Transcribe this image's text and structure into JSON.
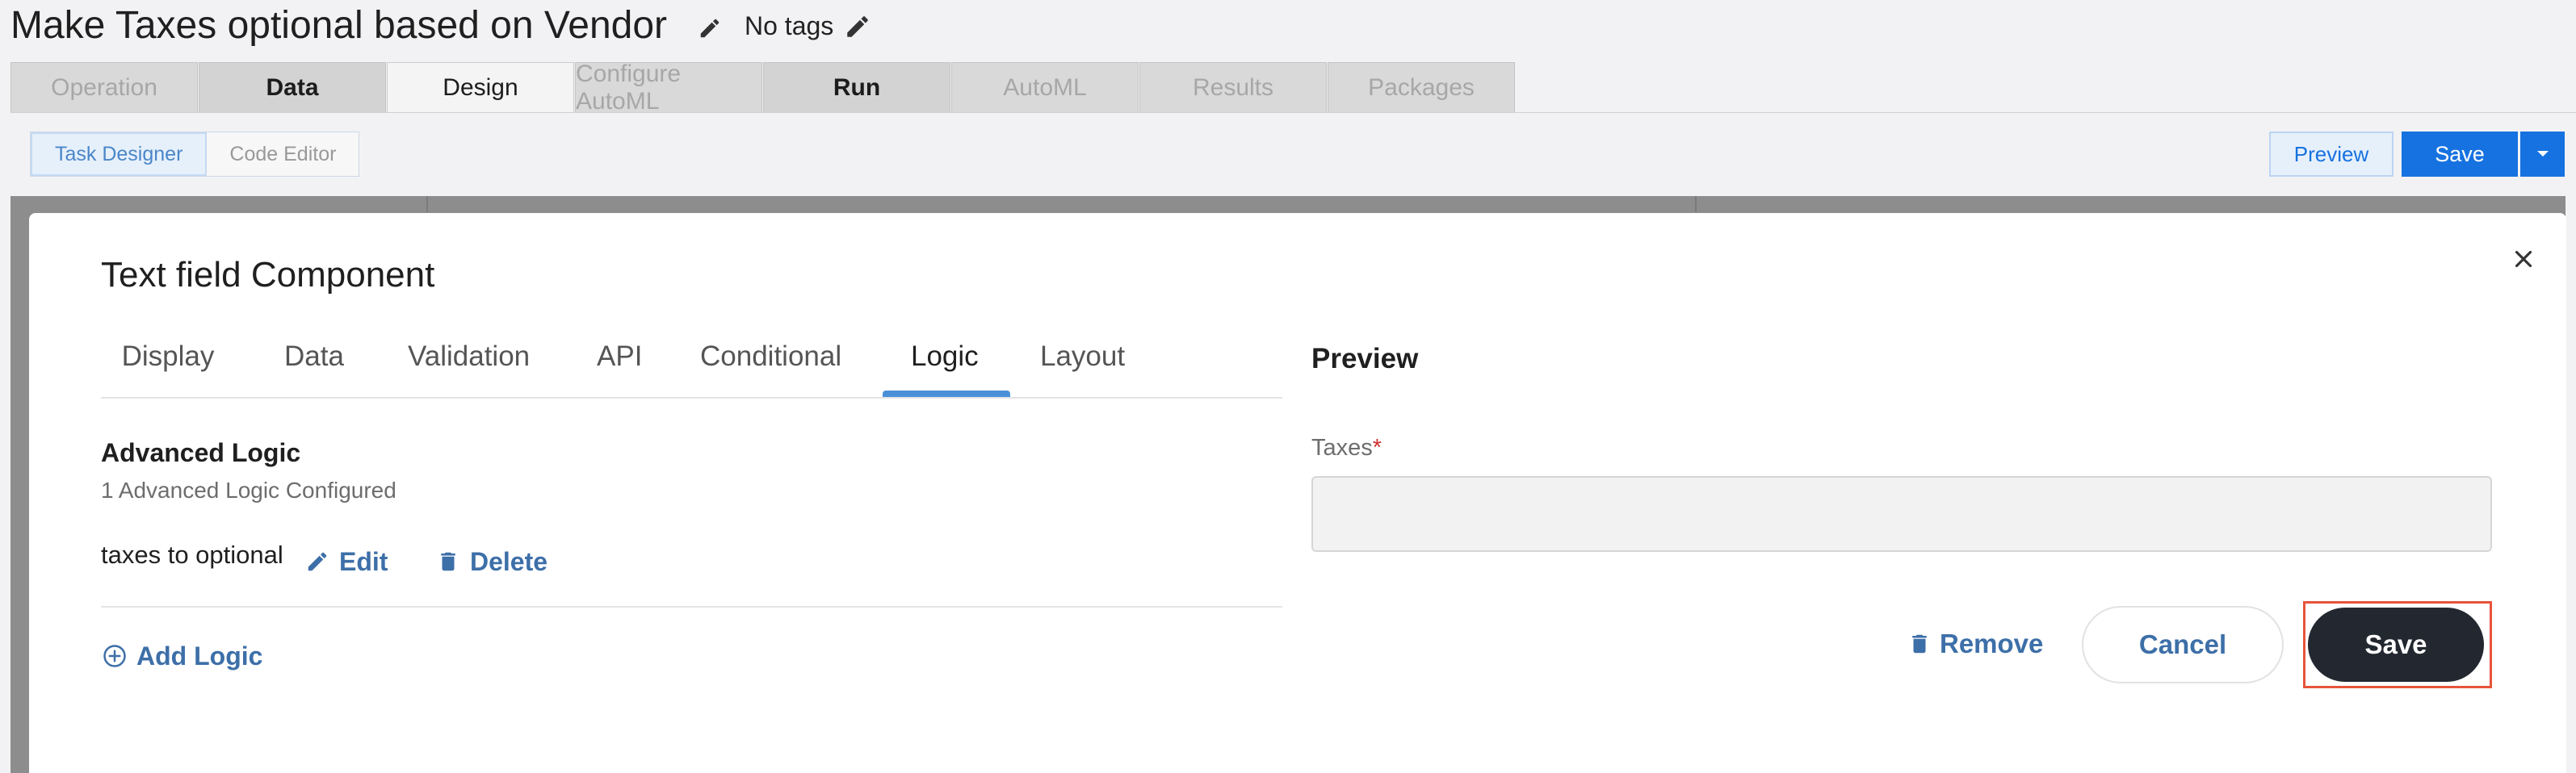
{
  "header": {
    "title": "Make Taxes optional based on Vendor",
    "tags_label": "No tags"
  },
  "main_tabs": [
    {
      "label": "Operation",
      "state": "disabled"
    },
    {
      "label": "Data",
      "state": "enabled"
    },
    {
      "label": "Design",
      "state": "active"
    },
    {
      "label": "Configure AutoML",
      "state": "disabled"
    },
    {
      "label": "Run",
      "state": "enabled"
    },
    {
      "label": "AutoML",
      "state": "disabled"
    },
    {
      "label": "Results",
      "state": "disabled"
    },
    {
      "label": "Packages",
      "state": "disabled"
    }
  ],
  "toolbar": {
    "task_designer": "Task Designer",
    "code_editor": "Code Editor",
    "preview": "Preview",
    "save": "Save"
  },
  "modal": {
    "title": "Text field Component",
    "tabs": [
      "Display",
      "Data",
      "Validation",
      "API",
      "Conditional",
      "Logic",
      "Layout"
    ],
    "active_tab": "Logic",
    "advanced_logic_title": "Advanced Logic",
    "advanced_logic_count": "1 Advanced Logic Configured",
    "logic_name": "taxes to optional",
    "edit_label": "Edit",
    "delete_label": "Delete",
    "add_logic_label": "Add Logic",
    "preview_title": "Preview",
    "field_label": "Taxes",
    "required_mark": "*",
    "field_value": "",
    "remove_label": "Remove",
    "cancel_label": "Cancel",
    "save_label": "Save"
  },
  "colors": {
    "primary_blue": "#1672e0",
    "link_blue": "#3d6fa8",
    "dark_button": "#232830",
    "highlight": "#e8533a",
    "required": "#d32f2f"
  }
}
